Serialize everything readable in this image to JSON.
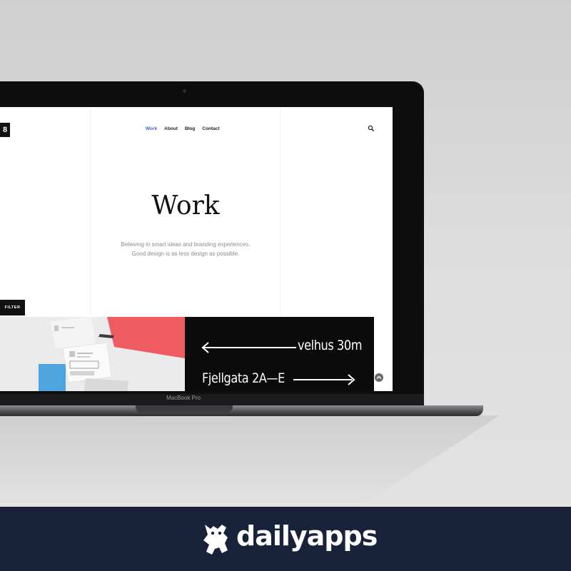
{
  "site": {
    "logo_text": "8",
    "nav": [
      {
        "label": "Work",
        "active": true
      },
      {
        "label": "About",
        "active": false
      },
      {
        "label": "Blog",
        "active": false
      },
      {
        "label": "Contact",
        "active": false
      }
    ],
    "hero_title": "Work",
    "hero_sub_line1": "Believing in smart ideas and branding experiences.",
    "hero_sub_line2": "Good design is as less design as possible.",
    "filter_label": "FILTER",
    "sign_line1": "velhus 30m",
    "sign_line2": "Fjellgata 2A—E",
    "accent_color": "#3a63d9"
  },
  "device": {
    "label": "MacBook Pro"
  },
  "footer": {
    "brand": "dailyapps",
    "background": "#182238"
  },
  "icons": {
    "search": "search-icon",
    "scroll_top": "scroll-top-icon",
    "brand_logo": "frog-logo-icon"
  }
}
